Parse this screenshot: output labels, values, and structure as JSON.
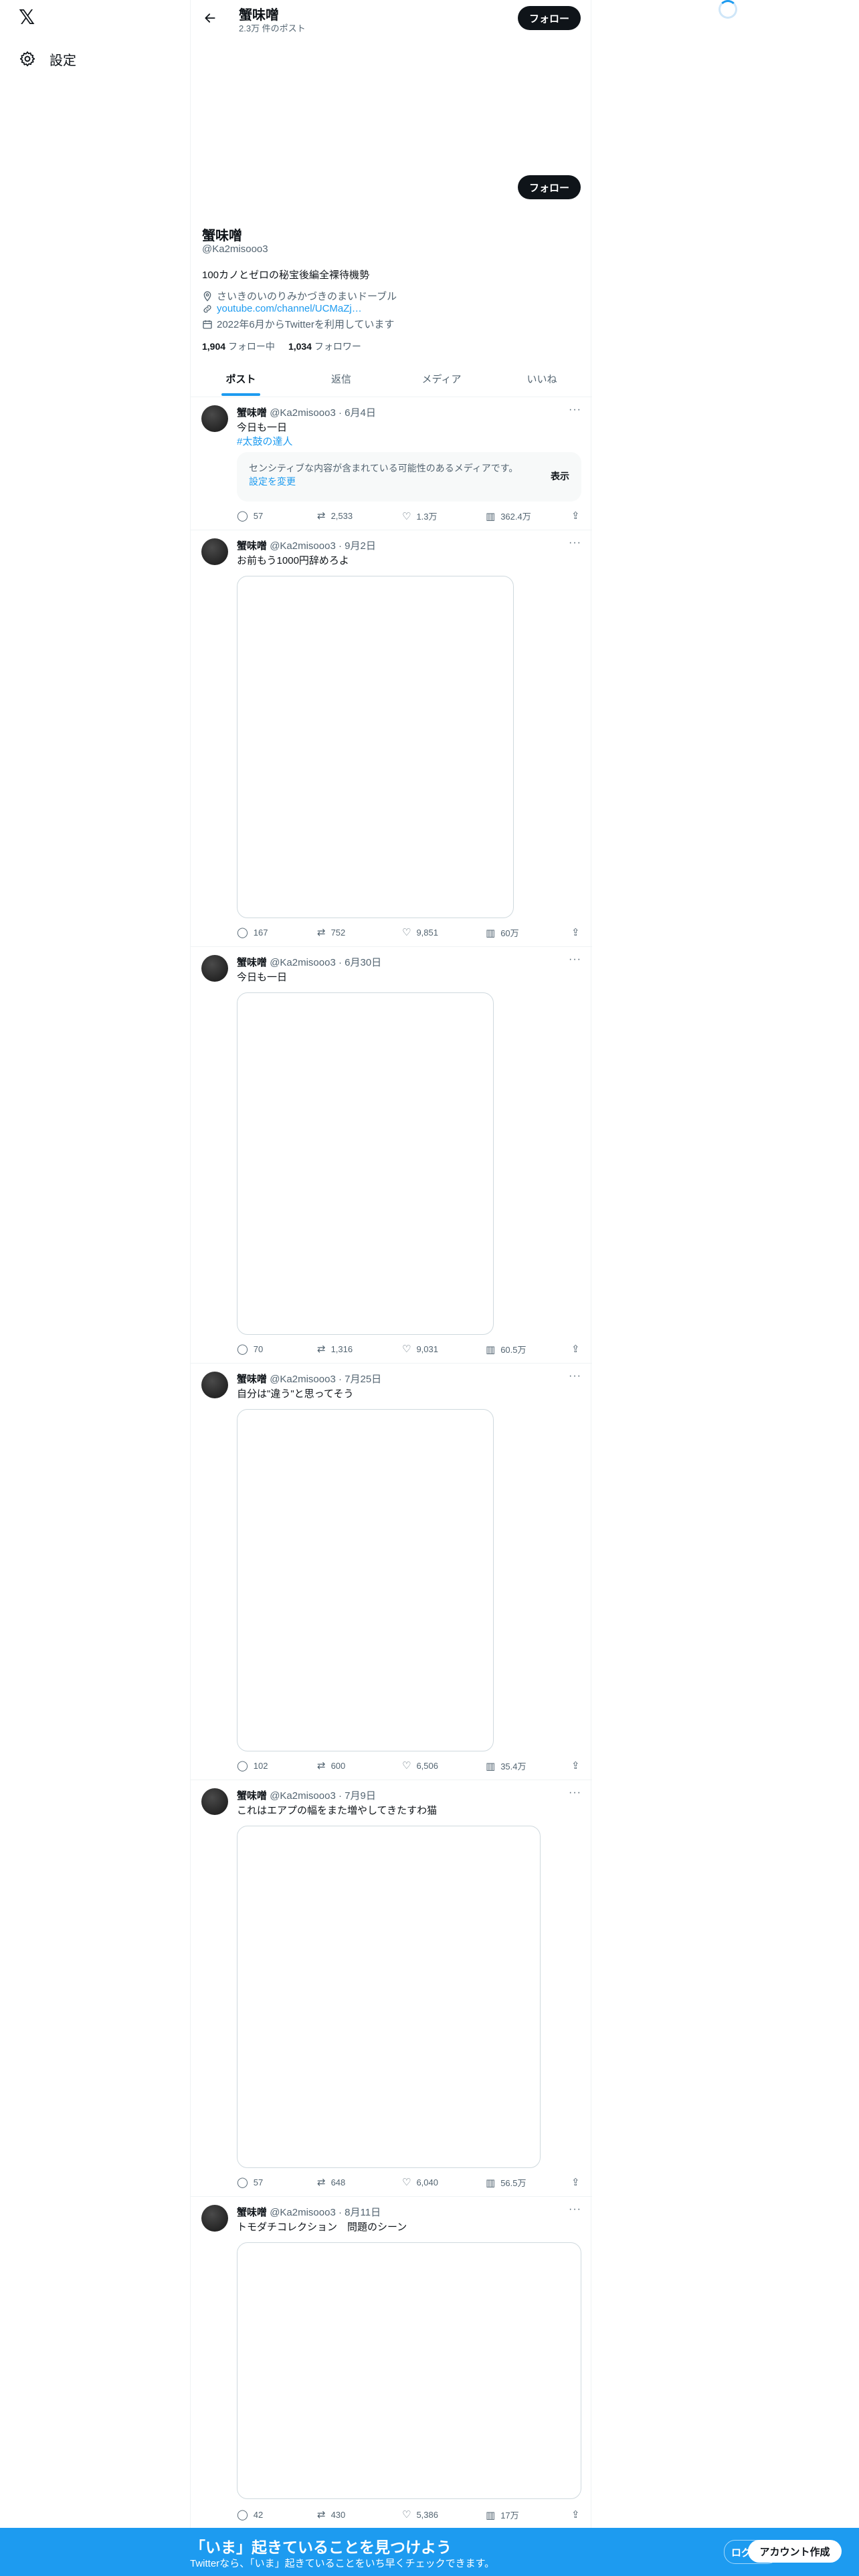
{
  "nav": {
    "logo": "𝕏",
    "settings_label": "設定"
  },
  "topbar": {
    "name": "蟹味噌",
    "post_count": "2.3万 件のポスト",
    "follow_label": "フォロー"
  },
  "profile": {
    "name": "蟹味噌",
    "handle": "@Ka2misooo3",
    "bio": "100カノとゼロの秘宝後編全裸待機勢",
    "location": "さいきのいのりみかづきのまいドーブル",
    "link": "youtube.com/channel/UCMaZj…",
    "joined": "2022年6月からTwitterを利用しています",
    "following_count": "1,904",
    "following_label": "フォロー中",
    "followers_count": "1,034",
    "followers_label": "フォロワー",
    "follow_label": "フォロー"
  },
  "tabs": [
    {
      "label": "ポスト"
    },
    {
      "label": "返信"
    },
    {
      "label": "メディア"
    },
    {
      "label": "いいね"
    }
  ],
  "posts": [
    {
      "name": "蟹味噌",
      "handle": "@Ka2misooo3",
      "date": "6月4日",
      "text": "今日も一日",
      "hashtag": "#太鼓の達人",
      "sensitive": {
        "text": "センシティブな内容が含まれている可能性のあるメディアです。",
        "link": "設定を変更",
        "show": "表示"
      },
      "replies": "57",
      "reposts": "2,533",
      "likes": "1.3万",
      "views": "362.4万"
    },
    {
      "name": "蟹味噌",
      "handle": "@Ka2misooo3",
      "date": "9月2日",
      "text": "お前もう1000円辞めろよ",
      "replies": "167",
      "reposts": "752",
      "likes": "9,851",
      "views": "60万"
    },
    {
      "name": "蟹味噌",
      "handle": "@Ka2misooo3",
      "date": "6月30日",
      "text": "今日も一日",
      "replies": "70",
      "reposts": "1,316",
      "likes": "9,031",
      "views": "60.5万"
    },
    {
      "name": "蟹味噌",
      "handle": "@Ka2misooo3",
      "date": "7月25日",
      "text": "自分は\"違う\"と思ってそう",
      "replies": "102",
      "reposts": "600",
      "likes": "6,506",
      "views": "35.4万"
    },
    {
      "name": "蟹味噌",
      "handle": "@Ka2misooo3",
      "date": "7月9日",
      "text": "これはエアプの幅をまた増やしてきたすわ猫",
      "replies": "57",
      "reposts": "648",
      "likes": "6,040",
      "views": "56.5万"
    },
    {
      "name": "蟹味噌",
      "handle": "@Ka2misooo3",
      "date": "8月11日",
      "text": "トモダチコレクション　問題のシーン",
      "replies": "42",
      "reposts": "430",
      "likes": "5,386",
      "views": "17万"
    }
  ],
  "bottombar": {
    "title": "「いま」起きていることを見つけよう",
    "subtitle": "Twitterなら、「いま」起きていることをいち早くチェックできます。",
    "login": "ログイン",
    "signup": "アカウント作成"
  },
  "icons": {
    "reply": "reply-icon",
    "repost": "repost-icon",
    "like": "heart-icon",
    "views": "bar-chart-icon",
    "share": "share-icon"
  },
  "colors": {
    "accent": "#1d9bf0",
    "text": "#0f1419",
    "muted": "#536471"
  }
}
